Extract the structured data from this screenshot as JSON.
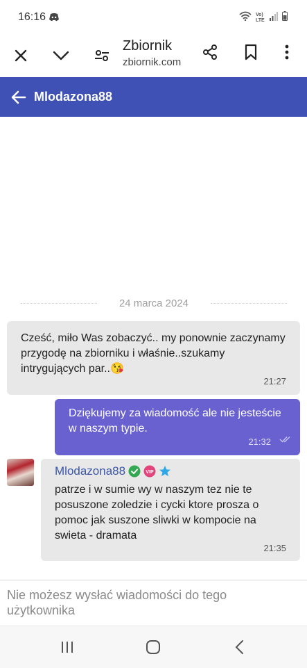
{
  "status_bar": {
    "time": "16:16",
    "network": "Vo) LTE"
  },
  "browser": {
    "site_title": "Zbiornik",
    "site_url": "zbiornik.com",
    "icons": [
      "close-icon",
      "chevron-down-icon",
      "page-settings-icon",
      "share-icon",
      "bookmark-icon",
      "more-vert-icon"
    ]
  },
  "header": {
    "title": "Mlodazona88",
    "color": "#3f51b5"
  },
  "date_separator": "24 marca 2024",
  "messages": [
    {
      "direction": "incoming",
      "text": "Cześć, miło Was zobaczyć.. my ponownie zaczynamy przygodę na zbiorniku i właśnie..szukamy intrygujących par..😘",
      "time": "21:27"
    },
    {
      "direction": "outgoing",
      "text": "Dziękujemy za wiadomość ale nie jesteście w naszym typie.",
      "time": "21:32",
      "status": "read"
    },
    {
      "direction": "incoming",
      "sender": "Mlodazona88",
      "badges": [
        "verified-icon",
        "vip-badge",
        "star-icon"
      ],
      "text": "patrze i w sumie wy w naszym tez nie te posuszone zoledzie i cycki ktore prosza o pomoc jak suszone sliwki w kompocie na swieta - dramata",
      "time": "21:35"
    }
  ],
  "composer": {
    "notice": "Nie możesz wysłać wiadomości do tego użytkownika"
  },
  "colors": {
    "outgoing_bubble": "#6a61d1",
    "incoming_bubble": "#e8e8e8",
    "sender_name": "#3a56a8"
  }
}
